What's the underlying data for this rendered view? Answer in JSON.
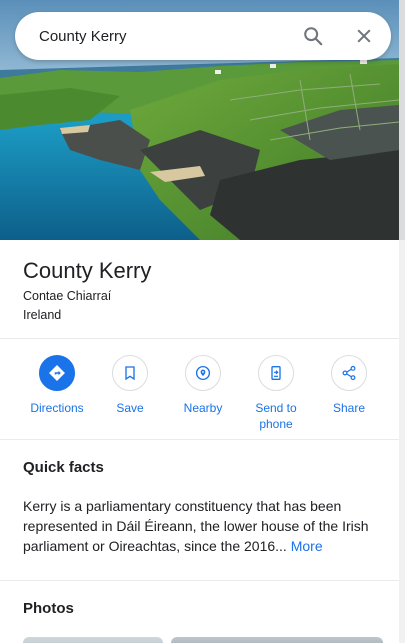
{
  "search": {
    "value": "County Kerry",
    "search_icon": "search-icon",
    "close_icon": "close-icon"
  },
  "place": {
    "title": "County Kerry",
    "subtitle_1": "Contae Chiarraí",
    "subtitle_2": "Ireland"
  },
  "actions": [
    {
      "label": "Directions",
      "icon": "directions-icon"
    },
    {
      "label": "Save",
      "icon": "bookmark-icon"
    },
    {
      "label": "Nearby",
      "icon": "nearby-icon"
    },
    {
      "label": "Send to phone",
      "icon": "send-to-phone-icon"
    },
    {
      "label": "Share",
      "icon": "share-icon"
    }
  ],
  "quick_facts": {
    "heading": "Quick facts",
    "text": "Kerry is a parliamentary constituency that has been represented in Dáil Éireann, the lower house of the Irish parliament or Oireachtas, since the 2016... ",
    "more_label": "More"
  },
  "photos": {
    "heading": "Photos"
  },
  "colors": {
    "accent": "#1a73e8",
    "text": "#202124",
    "divider": "#e8eaed"
  }
}
